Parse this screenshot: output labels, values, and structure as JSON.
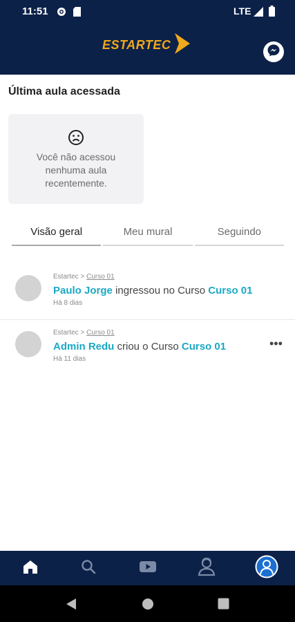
{
  "status_bar": {
    "time": "11:51",
    "network": "LTE"
  },
  "header": {
    "logo_text": "ESTARTEC",
    "brand_color": "#f0a81c",
    "bar_color": "#0c2148",
    "messenger_icon": "messenger-icon"
  },
  "last_lesson": {
    "title": "Última aula acessada",
    "empty_icon": "sad-face-icon",
    "empty_message": "Você não acessou nenhuma aula recentemente."
  },
  "tabs": [
    {
      "label": "Visão geral",
      "active": true
    },
    {
      "label": "Meu mural",
      "active": false
    },
    {
      "label": "Seguindo",
      "active": false
    }
  ],
  "feed": [
    {
      "crumb_root": "Estartec >",
      "crumb_course": "Curso 01",
      "user": "Paulo Jorge",
      "action": "ingressou no Curso",
      "course": "Curso 01",
      "time": "Há 8 dias",
      "has_menu": false
    },
    {
      "crumb_root": "Estartec >",
      "crumb_course": "Curso 01",
      "user": "Admin Redu",
      "action": "criou o Curso",
      "course": "Curso 01",
      "time": "Há 11 dias",
      "has_menu": true,
      "menu_glyph": "•••"
    }
  ],
  "bottom_nav": [
    {
      "icon": "home-icon",
      "active": true
    },
    {
      "icon": "search-icon",
      "active": false
    },
    {
      "icon": "video-icon",
      "active": false
    },
    {
      "icon": "contacts-icon",
      "active": false
    },
    {
      "icon": "profile-icon",
      "active": false
    }
  ],
  "accent_color": "#1aa8c4"
}
